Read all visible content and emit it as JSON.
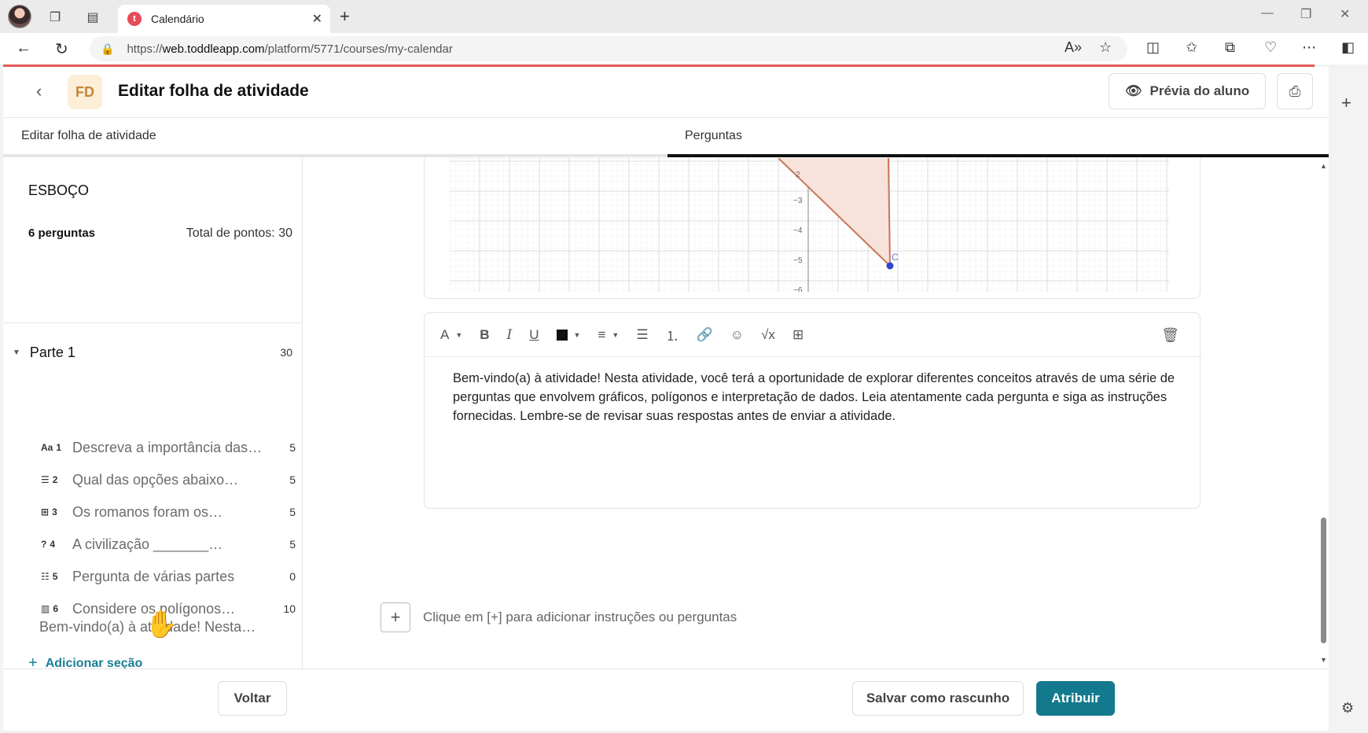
{
  "browser": {
    "tab_title": "Calendário",
    "tab_favicon_letter": "t",
    "url_scheme": "https://",
    "url_host": "web.toddleapp.com",
    "url_path": "/platform/5771/courses/my-calendar"
  },
  "header": {
    "badge": "FD",
    "title": "Editar folha de atividade",
    "preview_label": "Prévia do aluno"
  },
  "tabs": {
    "edit_label": "Editar folha de atividade",
    "questions_label": "Perguntas"
  },
  "outline": {
    "title": "ESBOÇO",
    "question_count": "6 perguntas",
    "total_points": "Total de pontos: 30",
    "part": {
      "label": "Parte 1",
      "points": "30"
    },
    "questions": [
      {
        "num": "1",
        "icon": "text-answer-icon",
        "glyph": "Aa",
        "text": "Descreva a importância das…",
        "points": "5"
      },
      {
        "num": "2",
        "icon": "multiple-choice-icon",
        "glyph": "☰",
        "text": "Qual das opções abaixo…",
        "points": "5"
      },
      {
        "num": "3",
        "icon": "matching-icon",
        "glyph": "⊞",
        "text": "Os romanos foram os…",
        "points": "5"
      },
      {
        "num": "4",
        "icon": "fill-blank-icon",
        "glyph": "?",
        "text": "A civilização _______…",
        "points": "5"
      },
      {
        "num": "5",
        "icon": "multipart-icon",
        "glyph": "☷",
        "text": "Pergunta de várias partes",
        "points": "0"
      },
      {
        "num": "6",
        "icon": "graph-icon",
        "glyph": "▥",
        "text": "Considere os polígonos…",
        "points": "10"
      }
    ],
    "intro_item": "Bem-vindo(a) à atividade! Nesta…",
    "add_section_label": "Adicionar seção"
  },
  "graph": {
    "y_ticks": [
      "−3",
      "−4",
      "−5",
      "−6"
    ],
    "partial_tick": "2",
    "point_label": "C",
    "colors": {
      "polygon_fill": "#f7e3dc",
      "polygon_stroke": "#c8765a",
      "point": "#3344cc",
      "grid": "#e6e6e6"
    }
  },
  "editor": {
    "toolbar": {
      "font_label": "A",
      "bold": "B",
      "italic": "I",
      "underline": "U",
      "formula": "√x"
    },
    "body_text": "Bem-vindo(a) à atividade! Nesta atividade, você terá a oportunidade de explorar diferentes conceitos através de uma série de perguntas que envolvem gráficos, polígonos e interpretação de dados. Leia atentamente cada pergunta e siga as instruções fornecidas. Lembre-se de revisar suas respostas antes de enviar a atividade."
  },
  "add_hint": "Clique em [+] para adicionar instruções ou perguntas",
  "footer": {
    "back_label": "Voltar",
    "draft_label": "Salvar como rascunho",
    "assign_label": "Atribuir"
  },
  "theme": {
    "accent": "#137a8d",
    "link": "#1a7f94",
    "progress_red": "#e35a5a"
  }
}
